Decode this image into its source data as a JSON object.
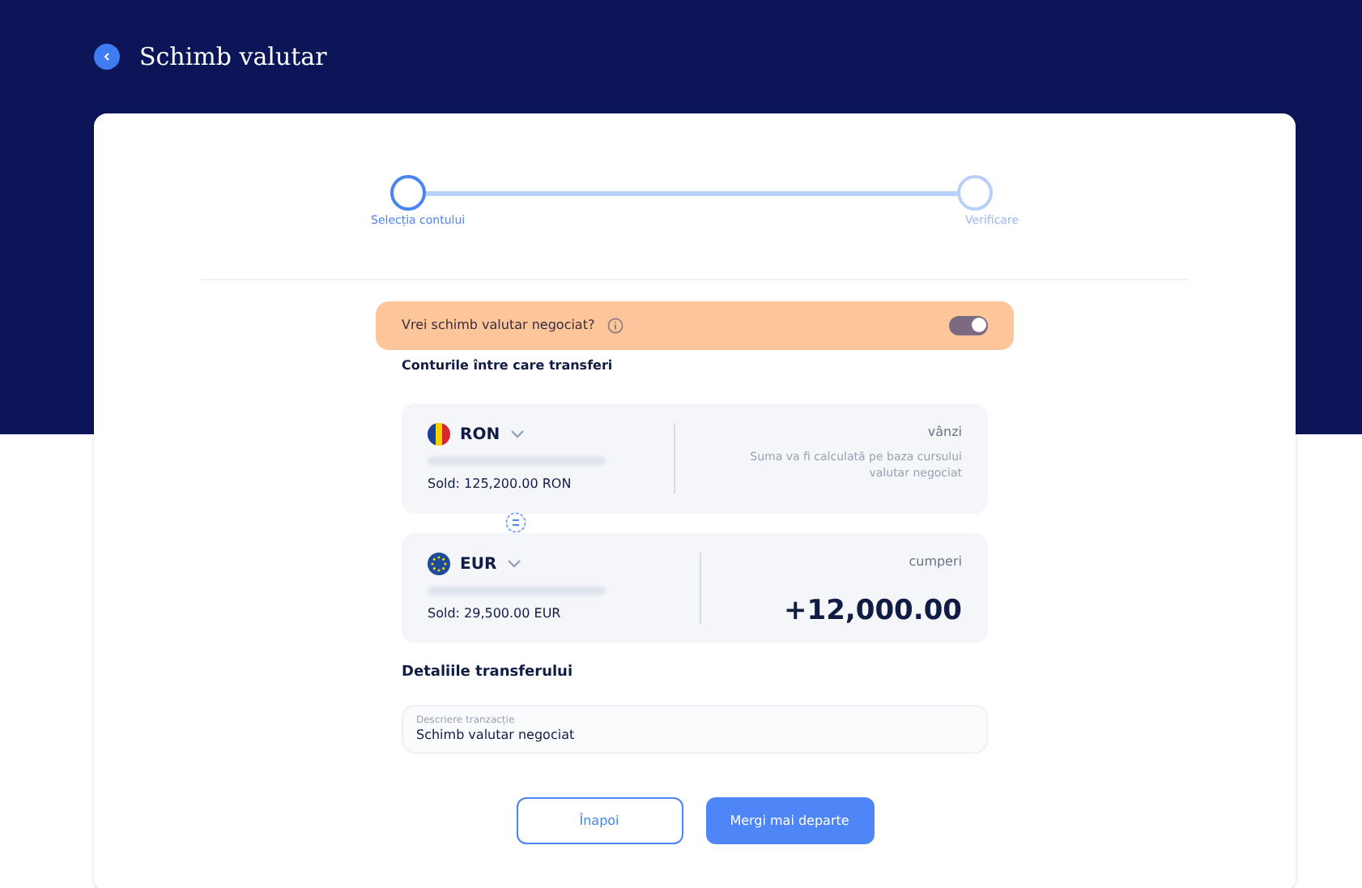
{
  "header": {
    "title": "Schimb valutar"
  },
  "steps": [
    {
      "label": "Selecția contului",
      "selected": true
    },
    {
      "label": "Verificare",
      "selected": false
    }
  ],
  "negotiated": {
    "label": "Vrei schimb valutar negociat?",
    "on": true
  },
  "accounts_heading": "Conturile între care transferi",
  "accounts": [
    {
      "currency": "RON",
      "kind": "ro",
      "balance": "Sold: 125,200.00 RON",
      "direction": "vânzi",
      "note": "Suma va fi calculată pe baza cursului valutar negociat"
    },
    {
      "currency": "EUR",
      "kind": "eu",
      "balance": "Sold: 29,500.00 EUR",
      "direction": "cumperi",
      "amount": "+12,000.00"
    }
  ],
  "details_heading": "Detaliile transferului",
  "description": {
    "label": "Descriere tranzacție",
    "value": "Schimb valutar negociat"
  },
  "buttons": {
    "back": "Înapoi",
    "next": "Mergi mai departe"
  }
}
